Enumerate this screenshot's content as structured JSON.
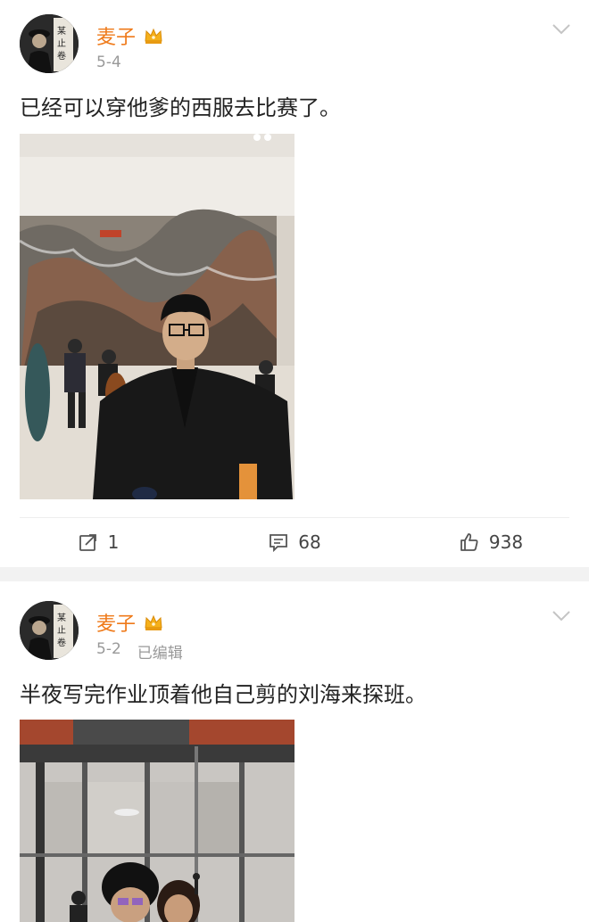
{
  "posts": [
    {
      "author": "麦子",
      "date": "5-4",
      "edited": "",
      "text": "已经可以穿他爹的西服去比赛了。",
      "actions": {
        "repost": "1",
        "comment": "68",
        "like": "938"
      }
    },
    {
      "author": "麦子",
      "date": "5-2",
      "edited": "已编辑",
      "text": "半夜写完作业顶着他自己剪的刘海来探班。"
    }
  ],
  "colors": {
    "author": "#ef7a1a",
    "meta": "#999999",
    "separator": "#f2f2f2"
  },
  "icons": [
    "crown-vip-icon",
    "chevron-down-icon",
    "repost-icon",
    "comment-icon",
    "like-icon"
  ]
}
